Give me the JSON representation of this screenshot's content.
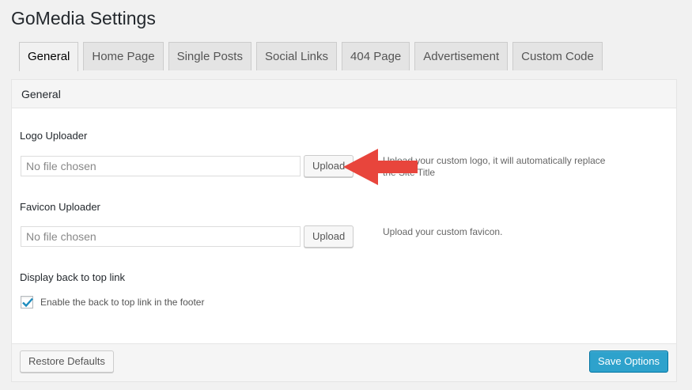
{
  "page": {
    "title": "GoMedia Settings"
  },
  "tabs": [
    {
      "label": "General",
      "active": true
    },
    {
      "label": "Home Page"
    },
    {
      "label": "Single Posts"
    },
    {
      "label": "Social Links"
    },
    {
      "label": "404 Page"
    },
    {
      "label": "Advertisement"
    },
    {
      "label": "Custom Code"
    }
  ],
  "panel": {
    "header": "General",
    "logo": {
      "label": "Logo Uploader",
      "placeholder": "No file chosen",
      "button": "Upload",
      "desc_line1": "Upload your custom logo, it will automatically replace",
      "desc_line2": "the Site Title"
    },
    "favicon": {
      "label": "Favicon Uploader",
      "placeholder": "No file chosen",
      "button": "Upload",
      "desc": "Upload your custom favicon."
    },
    "backtotop": {
      "label": "Display back to top link",
      "checkbox_label": "Enable the back to top link in the footer",
      "checked": true
    }
  },
  "footer": {
    "restore": "Restore Defaults",
    "save": "Save Options"
  },
  "colors": {
    "primary_button": "#2ea2cc",
    "annotation_arrow": "#e8453c",
    "checkmark": "#1e8cbe"
  }
}
